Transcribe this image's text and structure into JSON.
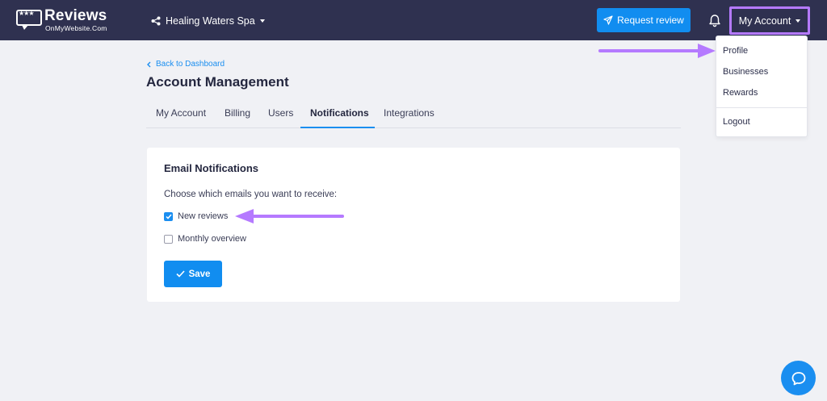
{
  "brand": {
    "name": "Reviews",
    "sub": "OnMyWebsite.Com",
    "stars": "★★★"
  },
  "header": {
    "business_selector": "Healing Waters Spa",
    "request_review_label": "Request review",
    "account_label": "My Account"
  },
  "dropdown": {
    "items": [
      "Profile",
      "Businesses",
      "Rewards",
      "Logout"
    ]
  },
  "page": {
    "back_label": "Back to Dashboard",
    "title": "Account Management",
    "tabs": [
      "My Account",
      "Billing",
      "Users",
      "Notifications",
      "Integrations"
    ],
    "active_tab": "Notifications"
  },
  "card": {
    "title": "Email Notifications",
    "description": "Choose which emails you want to receive:",
    "options": [
      {
        "label": "New reviews",
        "checked": true
      },
      {
        "label": "Monthly overview",
        "checked": false
      }
    ],
    "save_label": "Save"
  },
  "colors": {
    "nav_bg": "#2f3150",
    "accent": "#118df0",
    "highlight": "#b57aff",
    "page_bg": "#f0f1f5"
  },
  "icons": [
    "share-icon",
    "paper-plane-icon",
    "bell-icon",
    "chevron-left-icon",
    "checkmark-icon",
    "chat-bubble-icon"
  ]
}
